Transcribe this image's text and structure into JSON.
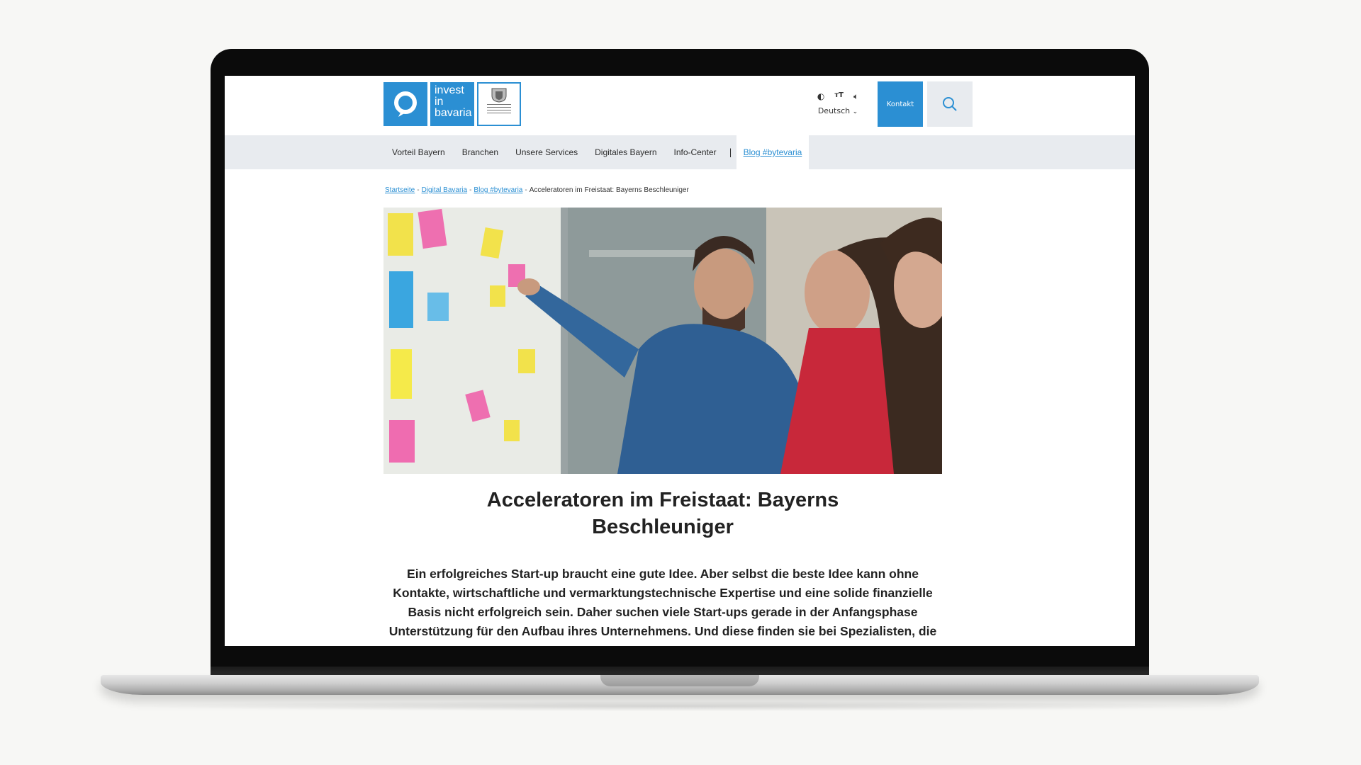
{
  "colors": {
    "accent": "#2b8fd3",
    "nav_bg": "#e8ebef",
    "text": "#222222"
  },
  "logo": {
    "text_lines": [
      "invest",
      "in",
      "bavaria"
    ]
  },
  "tools": {
    "icons": [
      "contrast-icon",
      "text-size-icon",
      "audio-icon"
    ],
    "language": "Deutsch"
  },
  "header": {
    "contact_label": "Kontakt"
  },
  "nav": {
    "items": [
      "Vorteil Bayern",
      "Branchen",
      "Unsere Services",
      "Digitales Bayern",
      "Info-Center"
    ],
    "separator": "|",
    "active": "Blog #bytevaria"
  },
  "breadcrumb": {
    "links": [
      "Startseite",
      "Digital Bavaria",
      "Blog #bytevaria"
    ],
    "current": "Acceleratoren im Freistaat: Bayerns Beschleuniger",
    "separator": "-"
  },
  "article": {
    "title_line1": "Acceleratoren im Freistaat: Bayerns",
    "title_line2": "Beschleuniger",
    "lead": "Ein erfolgreiches Start-up braucht eine gute Idee. Aber selbst die beste Idee kann ohne Kontakte, wirtschaftliche und vermarktungstechnische Expertise und eine solide finanzielle Basis nicht erfolgreich sein. Daher suchen viele Start-ups gerade in der Anfangsphase Unterstützung für den Aufbau ihres Unternehmens. Und diese finden sie bei Spezialisten, die"
  }
}
